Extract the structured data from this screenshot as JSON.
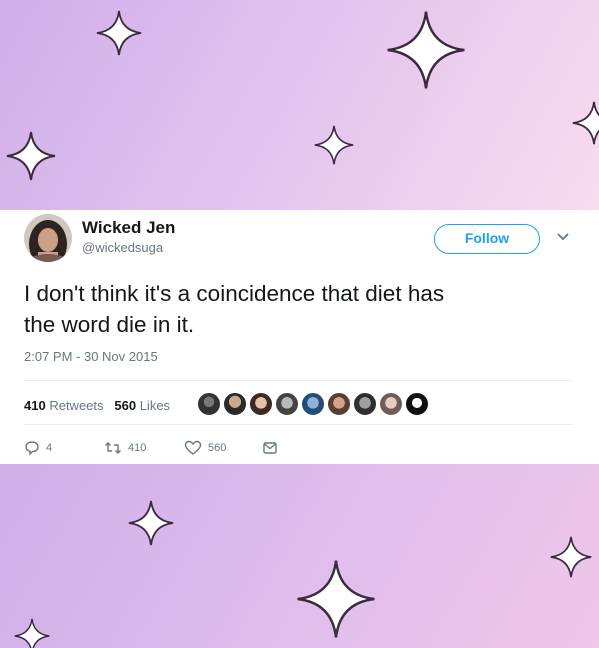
{
  "tweet": {
    "display_name": "Wicked Jen",
    "handle": "@wickedsuga",
    "follow_label": "Follow",
    "text_line1": "I don't think it's a coincidence that diet has",
    "text_line2": "the word die in it.",
    "timestamp": "2:07 PM - 30 Nov 2015",
    "retweets_count": "410",
    "retweets_label": "Retweets",
    "likes_count": "560",
    "likes_label": "Likes",
    "reply_count": "4",
    "retweet_action_count": "410",
    "like_action_count": "560"
  },
  "colors": {
    "accent": "#1da1f2",
    "text": "#14171a",
    "muted": "#657786",
    "background_gradient": [
      "#cfaee9",
      "#f8dcee"
    ]
  },
  "icons": [
    "reply-icon",
    "retweet-icon",
    "heart-icon",
    "message-icon",
    "chevron-down-icon",
    "sparkle-icon"
  ]
}
